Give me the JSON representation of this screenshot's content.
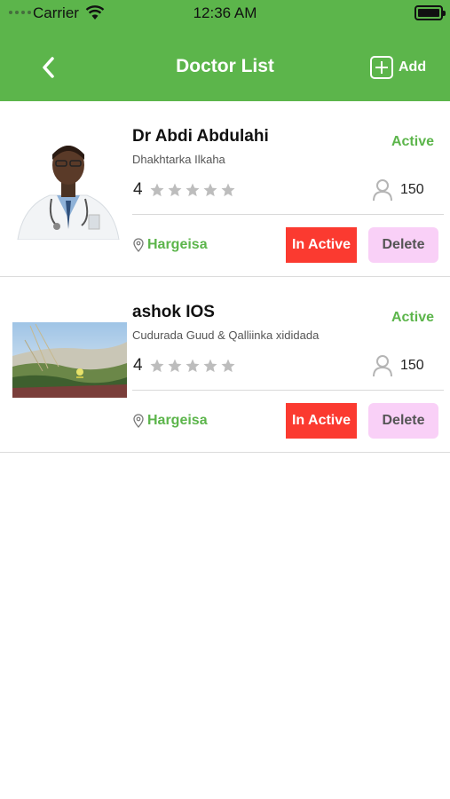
{
  "status_bar": {
    "carrier": "Carrier",
    "time": "12:36 AM"
  },
  "header": {
    "title": "Doctor List",
    "back_icon": "chevron-left-icon",
    "add_label": "Add",
    "add_icon": "plus-square-icon"
  },
  "colors": {
    "header_green": "#5cb54b",
    "inactive_red": "#fb3a30",
    "delete_pink": "#f9d0f7",
    "star_gray": "#bdbdbd"
  },
  "doctors": [
    {
      "name": "Dr Abdi Abdulahi",
      "specialty": "Dhakhtarka Ilkaha",
      "status": "Active",
      "rating": "4",
      "stars_total": 5,
      "patients": "150",
      "city": "Hargeisa",
      "inactive_label": "In Active",
      "delete_label": "Delete"
    },
    {
      "name": "ashok IOS",
      "specialty": "Cudurada Guud & Qalliinka xididada",
      "status": "Active",
      "rating": "4",
      "stars_total": 5,
      "patients": "150",
      "city": "Hargeisa",
      "inactive_label": "In Active",
      "delete_label": "Delete"
    }
  ]
}
